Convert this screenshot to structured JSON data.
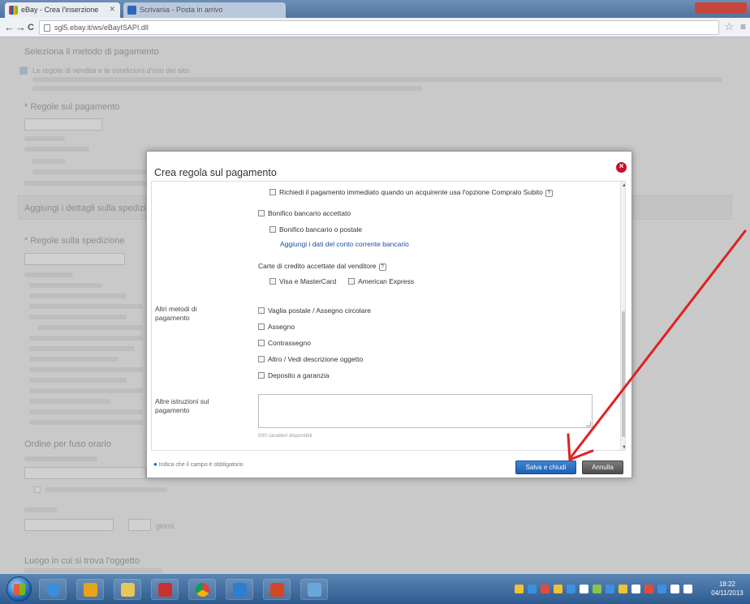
{
  "browser": {
    "tab_active": "eBay - Crea l'inserzione",
    "tab_other": "Scrivania - Posta in arrivo",
    "address": "sgl5.ebay.it/ws/eBayISAPI.dll",
    "back_glyph": "←",
    "forward_glyph": "→",
    "reload_glyph": "C",
    "star_glyph": "☆",
    "menu_glyph": "≡"
  },
  "background": {
    "section1_title": "Seleziona il metodo di pagamento",
    "notice": "Le regole di vendita e le condizioni d'uso del sito",
    "payment_rules_label": "* Regole sul pagamento",
    "shipping_section": "Aggiungi i dettagli sulla spedizione",
    "shipping_rules_label": "* Regole sulla spedizione",
    "other_options": "Ordine per fuso orario",
    "item_location": "Luogo in cui si trova l'oggetto",
    "days": "giorni"
  },
  "modal": {
    "title": "Crea regola sul pagamento",
    "close_glyph": "×",
    "immediate_payment": "Richiedi il pagamento immediato quando un acquirente usa l'opzione Compralo Subito",
    "bank_transfer": "Bonifico bancario accettato",
    "postal_transfer": "Bonifico bancario o postale",
    "add_bank_details": "Aggiungi i dati del conto corrente bancario",
    "credit_cards_label": "Carte di credito accettate dal venditore",
    "visa_mc": "Visa e MasterCard",
    "amex": "American Express",
    "other_methods_label": "Altri metodi di pagamento",
    "postal_order": "Vaglia postale / Assegno circolare",
    "cheque": "Assegno",
    "cod": "Contrassegno",
    "see_description": "Altro / Vedi descrizione oggetto",
    "escrow": "Deposito a garanzia",
    "instructions_label": "Altre istruzioni sul pagamento",
    "char_count": "500 caratteri disponibili",
    "help_glyph": "?",
    "required_note": "Indica che il campo è obbligatorio",
    "required_marker": "●",
    "save_button": "Salva e chiudi",
    "cancel_button": "Annulla",
    "scroll_up_glyph": "▲",
    "scroll_down_glyph": "▼"
  },
  "taskbar": {
    "time": "18:22",
    "date": "04/11/2013"
  },
  "colors": {
    "accent_blue": "#1e5eb0",
    "close_red": "#c8102e",
    "annotation_arrow": "#e02020"
  }
}
